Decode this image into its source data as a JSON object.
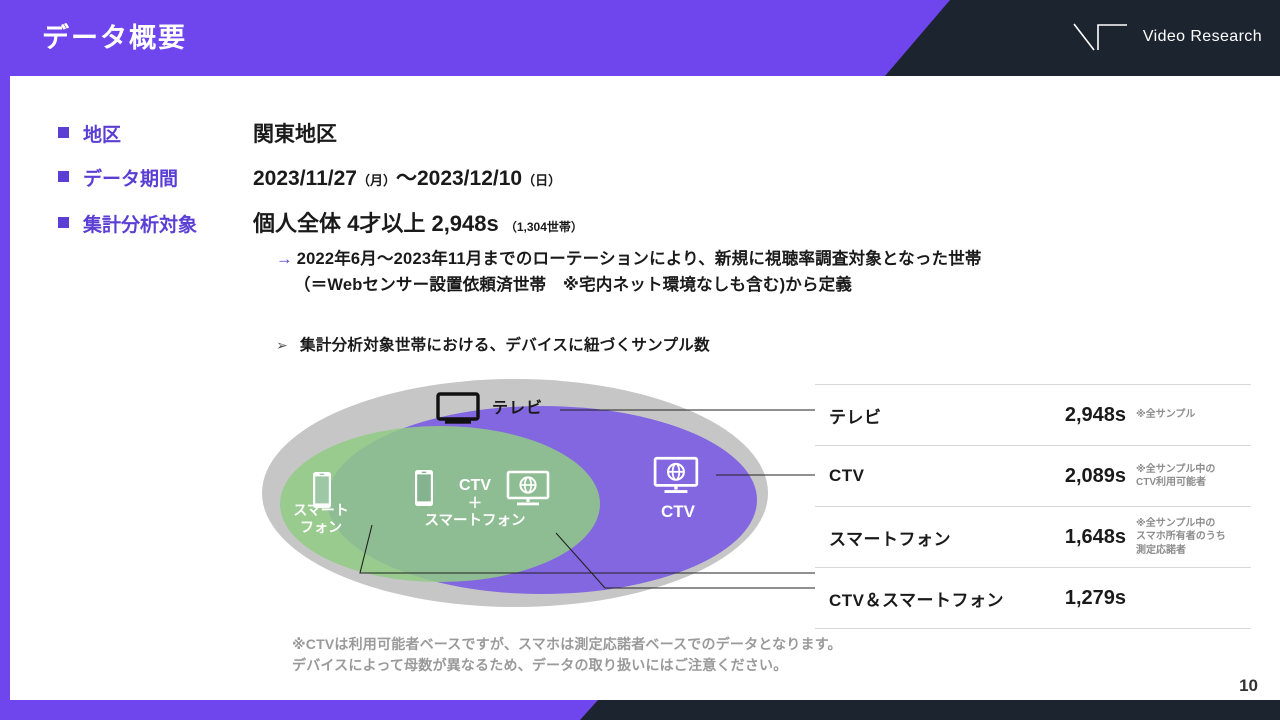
{
  "header": {
    "title": "データ概要",
    "logo_text": "Video Research",
    "logo_icon": "video-research-logo-icon",
    "bg_color": "#6F45ED",
    "dark_color": "#1C2430"
  },
  "bullets": [
    {
      "label": "地区",
      "value": "関東地区"
    },
    {
      "label": "データ期間",
      "value_a": "2023/11/27",
      "value_b": "（月）",
      "value_c": "〜2023/12/10",
      "value_d": "（日）"
    },
    {
      "label": "集計分析対象",
      "value_a": "個人全体 4才以上 2,948s",
      "value_b": "（1,304世帯）"
    }
  ],
  "arrow_note": {
    "arrow": "→",
    "line1": "2022年6月〜2023年11月までのローテーションにより、新規に視聴率調査対象となった世帯",
    "line2": "（＝Webセンサー設置依頼済世帯　※宅内ネット環境なしも含む)から定義"
  },
  "subheading": {
    "marker": "➢",
    "text": "集計分析対象世帯における、デバイスに紐づくサンプル数"
  },
  "venn": {
    "tv_label": "テレビ",
    "tv_icon": "tv-icon",
    "smartphone_label": "スマート\nフォン",
    "smartphone_icon": "smartphone-icon",
    "middle_label_line1": "CTV",
    "middle_label_plus": "＋",
    "middle_label_line2": "スマートフォン",
    "middle_smartphone_icon": "smartphone-icon",
    "middle_ctv_icon": "ctv-monitor-globe-icon",
    "ctv_label": "CTV",
    "ctv_icon": "ctv-monitor-globe-icon",
    "outer_color": "#C6C6C6",
    "purple_color": "#8267E0",
    "green_color": "#92CC86",
    "overlap_color": "#7CAF8A"
  },
  "table": {
    "rows": [
      {
        "name": "テレビ",
        "value": "2,948s",
        "note": "※全サンプル"
      },
      {
        "name": "CTV",
        "value": "2,089s",
        "note": "※全サンプル中の\nCTV利用可能者"
      },
      {
        "name": "スマートフォン",
        "value": "1,648s",
        "note": "※全サンプル中の\nスマホ所有者のうち\n測定応諾者"
      },
      {
        "name": "CTV＆スマートフォン",
        "value": "1,279s",
        "note": ""
      }
    ]
  },
  "footnote": {
    "line1": "※CTVは利用可能者ベースですが、スマホは測定応諾者ベースでのデータとなります。",
    "line2": "デバイスによって母数が異なるため、データの取り扱いにはご注意ください。"
  },
  "page_number": "10"
}
